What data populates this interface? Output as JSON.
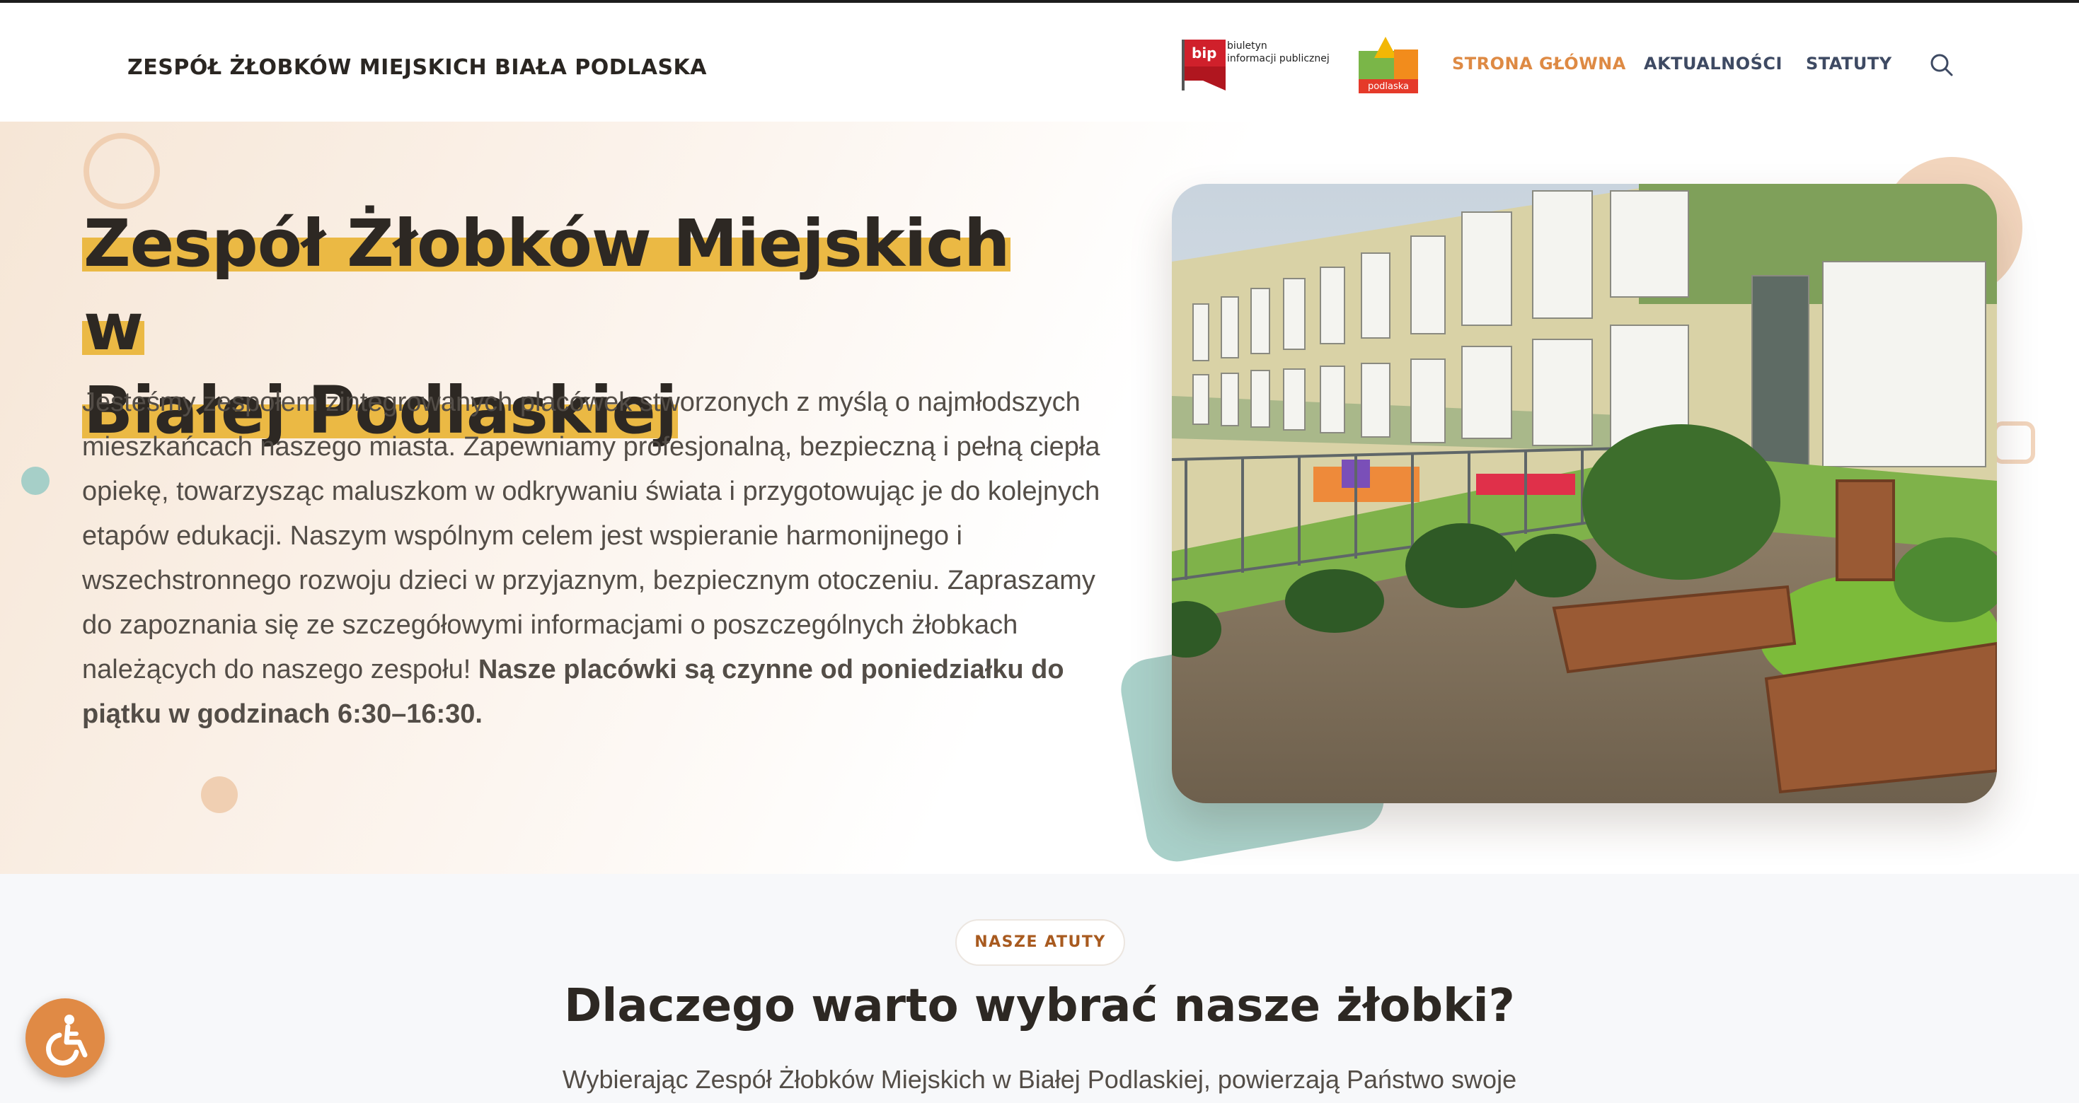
{
  "header": {
    "site_title": "ZESPÓŁ ŻŁOBKÓW MIEJSKICH BIAŁA PODLASKA",
    "bip_logo": {
      "mark": "bip",
      "line1": "biuletyn",
      "line2": "informacji publicznej"
    },
    "city_logo": {
      "text": "podlaska"
    },
    "nav": [
      {
        "label": "STRONA GŁÓWNA",
        "active": true
      },
      {
        "label": "AKTUALNOŚCI",
        "active": false
      },
      {
        "label": "STATUTY",
        "active": false
      }
    ],
    "search_icon": "search-icon"
  },
  "hero": {
    "title_line1": "Zespół Żłobków Miejskich w",
    "title_line2": "Białej Podlaskiej",
    "text": "Jesteśmy zespołem zintegrowanych placówek stworzonych z myślą o najmłodszych mieszkańcach naszego miasta. Zapewniamy profesjonalną, bezpieczną i pełną ciepła opiekę, towarzysząc maluszkom w odkrywaniu świata i przygotowując je do kolejnych etapów edukacji. Naszym wspólnym celem jest wspieranie harmonijnego i wszechstronnego rozwoju dzieci w przyjaznym, bezpiecznym otoczeniu. Zapraszamy do zapoznania się ze szczegółowymi informacjami o poszczególnych żłobkach należących do naszego zespołu!",
    "text_bold": "Nasze placówki są czynne od poniedziałku do piątku w godzinach 6:30–16:30."
  },
  "features": {
    "badge": "NASZE ATUTY",
    "title": "Dlaczego warto wybrać nasze żłobki?",
    "text": "Wybierając Zespół Żłobków Miejskich w Białej Podlaskiej, powierzają Państwo swoje"
  },
  "accessibility": {
    "icon": "wheelchair-icon"
  },
  "colors": {
    "accent_orange": "#de8a44",
    "highlight_yellow": "#ebb944",
    "nav_dark": "#3e4a63",
    "teal": "#a9d0c9",
    "peach": "#f2d5bd"
  }
}
